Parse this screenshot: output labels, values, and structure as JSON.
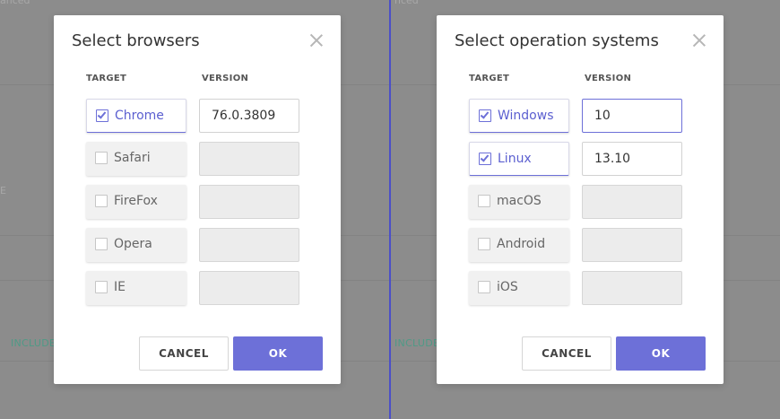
{
  "background": {
    "left_top_text": "anced",
    "left_mid_text": "E",
    "left_include": "INCLUDE",
    "right_top_text": "nced",
    "right_include": "INCLUDE"
  },
  "browsers_dialog": {
    "title": "Select browsers",
    "col_target": "TARGET",
    "col_version": "VERSION",
    "rows": [
      {
        "label": "Chrome",
        "checked": true,
        "version": "76.0.3809"
      },
      {
        "label": "Safari",
        "checked": false,
        "version": ""
      },
      {
        "label": "FireFox",
        "checked": false,
        "version": ""
      },
      {
        "label": "Opera",
        "checked": false,
        "version": ""
      },
      {
        "label": "IE",
        "checked": false,
        "version": ""
      }
    ],
    "cancel_label": "CANCEL",
    "ok_label": "OK"
  },
  "os_dialog": {
    "title": "Select operation systems",
    "col_target": "TARGET",
    "col_version": "VERSION",
    "rows": [
      {
        "label": "Windows",
        "checked": true,
        "version": "10"
      },
      {
        "label": "Linux",
        "checked": true,
        "version": "13.10"
      },
      {
        "label": "macOS",
        "checked": false,
        "version": ""
      },
      {
        "label": "Android",
        "checked": false,
        "version": ""
      },
      {
        "label": "iOS",
        "checked": false,
        "version": ""
      }
    ],
    "cancel_label": "CANCEL",
    "ok_label": "OK"
  },
  "colors": {
    "accent": "#6d70d8",
    "divider": "#4b4fc8",
    "include_text": "#4f9a86"
  }
}
